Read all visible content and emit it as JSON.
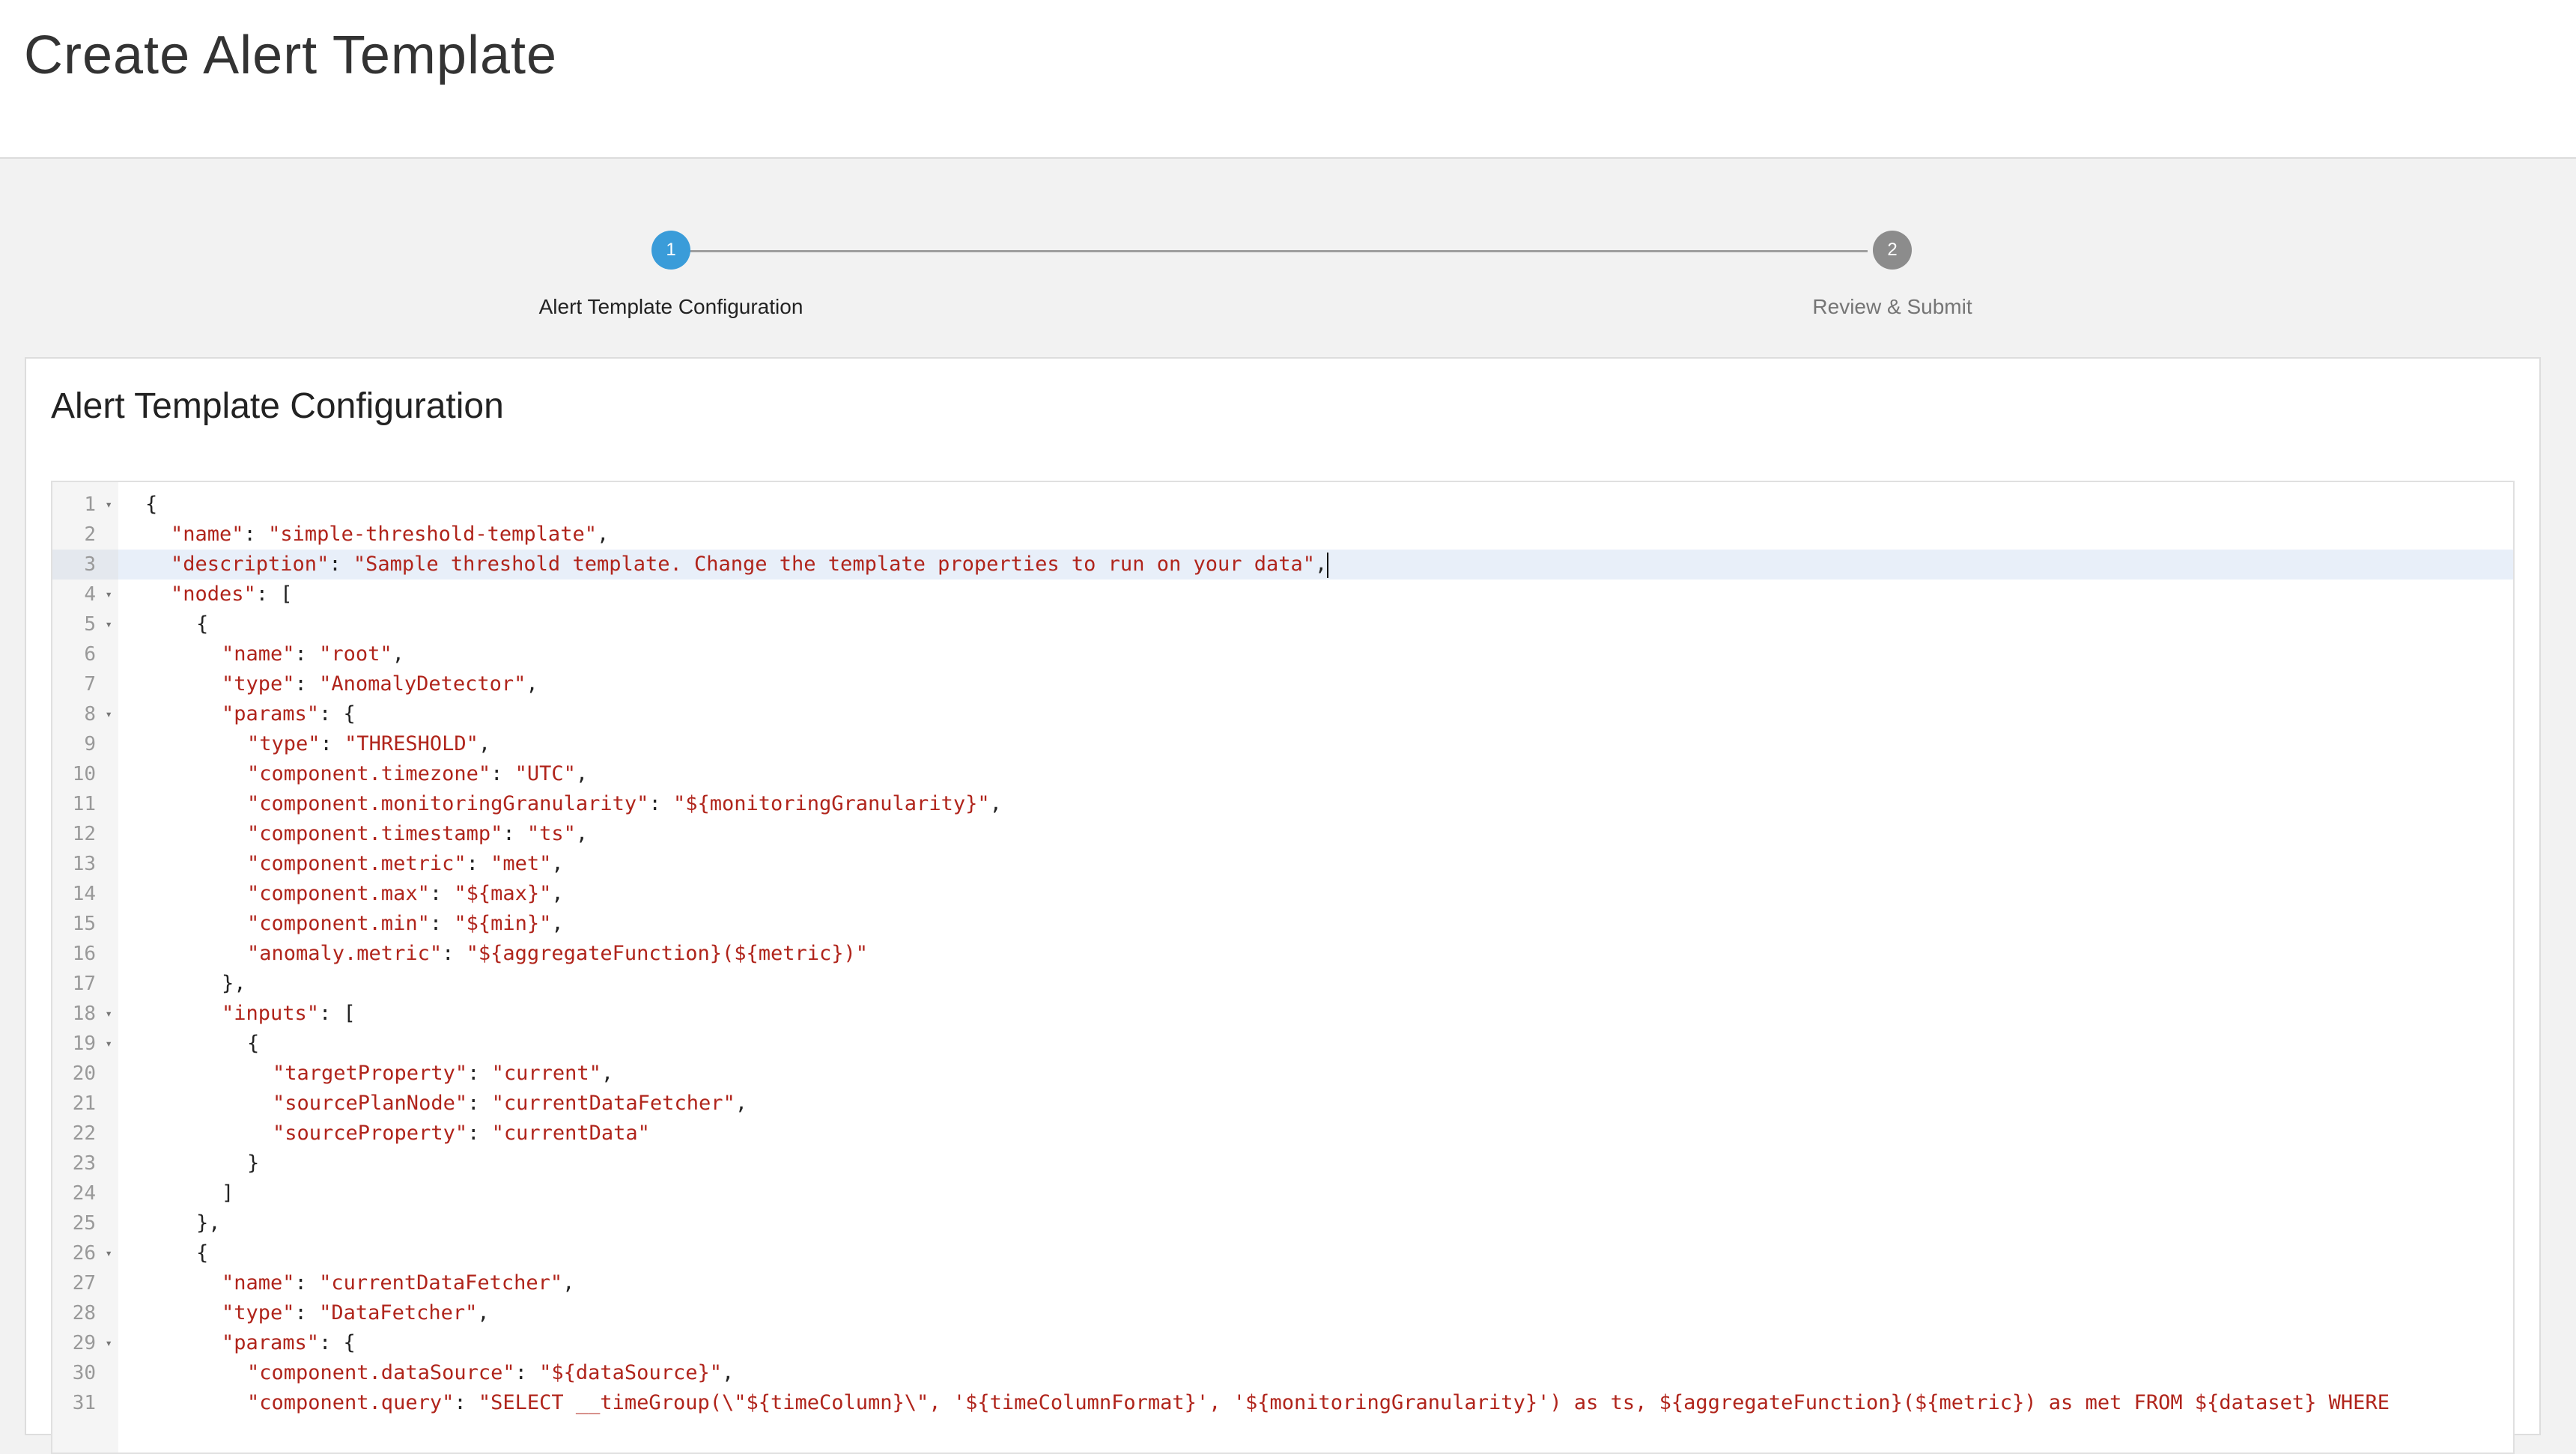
{
  "page": {
    "title": "Create Alert Template"
  },
  "stepper": {
    "steps": [
      {
        "number": "1",
        "label": "Alert Template Configuration",
        "state": "active",
        "color": "#3a9cd9"
      },
      {
        "number": "2",
        "label": "Review & Submit",
        "state": "inactive",
        "color": "#8c8c8c"
      }
    ]
  },
  "card": {
    "title": "Alert Template Configuration"
  },
  "editor": {
    "active_line": 3,
    "lines": [
      {
        "n": "1",
        "fold": true,
        "indent": 0,
        "parts": [
          [
            "p",
            "{"
          ]
        ]
      },
      {
        "n": "2",
        "fold": false,
        "indent": 1,
        "parts": [
          [
            "k",
            "\"name\""
          ],
          [
            "p",
            ": "
          ],
          [
            "s",
            "\"simple-threshold-template\""
          ],
          [
            "p",
            ","
          ]
        ]
      },
      {
        "n": "3",
        "fold": false,
        "indent": 1,
        "parts": [
          [
            "k",
            "\"description\""
          ],
          [
            "p",
            ": "
          ],
          [
            "s",
            "\"Sample threshold template. Change the template properties to run on your data\""
          ],
          [
            "p",
            ","
          ]
        ],
        "cursor": true
      },
      {
        "n": "4",
        "fold": true,
        "indent": 1,
        "parts": [
          [
            "k",
            "\"nodes\""
          ],
          [
            "p",
            ": ["
          ]
        ]
      },
      {
        "n": "5",
        "fold": true,
        "indent": 2,
        "parts": [
          [
            "p",
            "{"
          ]
        ]
      },
      {
        "n": "6",
        "fold": false,
        "indent": 3,
        "parts": [
          [
            "k",
            "\"name\""
          ],
          [
            "p",
            ": "
          ],
          [
            "s",
            "\"root\""
          ],
          [
            "p",
            ","
          ]
        ]
      },
      {
        "n": "7",
        "fold": false,
        "indent": 3,
        "parts": [
          [
            "k",
            "\"type\""
          ],
          [
            "p",
            ": "
          ],
          [
            "s",
            "\"AnomalyDetector\""
          ],
          [
            "p",
            ","
          ]
        ]
      },
      {
        "n": "8",
        "fold": true,
        "indent": 3,
        "parts": [
          [
            "k",
            "\"params\""
          ],
          [
            "p",
            ": {"
          ]
        ]
      },
      {
        "n": "9",
        "fold": false,
        "indent": 4,
        "parts": [
          [
            "k",
            "\"type\""
          ],
          [
            "p",
            ": "
          ],
          [
            "s",
            "\"THRESHOLD\""
          ],
          [
            "p",
            ","
          ]
        ]
      },
      {
        "n": "10",
        "fold": false,
        "indent": 4,
        "parts": [
          [
            "k",
            "\"component.timezone\""
          ],
          [
            "p",
            ": "
          ],
          [
            "s",
            "\"UTC\""
          ],
          [
            "p",
            ","
          ]
        ]
      },
      {
        "n": "11",
        "fold": false,
        "indent": 4,
        "parts": [
          [
            "k",
            "\"component.monitoringGranularity\""
          ],
          [
            "p",
            ": "
          ],
          [
            "s",
            "\"${monitoringGranularity}\""
          ],
          [
            "p",
            ","
          ]
        ]
      },
      {
        "n": "12",
        "fold": false,
        "indent": 4,
        "parts": [
          [
            "k",
            "\"component.timestamp\""
          ],
          [
            "p",
            ": "
          ],
          [
            "s",
            "\"ts\""
          ],
          [
            "p",
            ","
          ]
        ]
      },
      {
        "n": "13",
        "fold": false,
        "indent": 4,
        "parts": [
          [
            "k",
            "\"component.metric\""
          ],
          [
            "p",
            ": "
          ],
          [
            "s",
            "\"met\""
          ],
          [
            "p",
            ","
          ]
        ]
      },
      {
        "n": "14",
        "fold": false,
        "indent": 4,
        "parts": [
          [
            "k",
            "\"component.max\""
          ],
          [
            "p",
            ": "
          ],
          [
            "s",
            "\"${max}\""
          ],
          [
            "p",
            ","
          ]
        ]
      },
      {
        "n": "15",
        "fold": false,
        "indent": 4,
        "parts": [
          [
            "k",
            "\"component.min\""
          ],
          [
            "p",
            ": "
          ],
          [
            "s",
            "\"${min}\""
          ],
          [
            "p",
            ","
          ]
        ]
      },
      {
        "n": "16",
        "fold": false,
        "indent": 4,
        "parts": [
          [
            "k",
            "\"anomaly.metric\""
          ],
          [
            "p",
            ": "
          ],
          [
            "s",
            "\"${aggregateFunction}(${metric})\""
          ]
        ]
      },
      {
        "n": "17",
        "fold": false,
        "indent": 3,
        "parts": [
          [
            "p",
            "},"
          ]
        ]
      },
      {
        "n": "18",
        "fold": true,
        "indent": 3,
        "parts": [
          [
            "k",
            "\"inputs\""
          ],
          [
            "p",
            ": ["
          ]
        ]
      },
      {
        "n": "19",
        "fold": true,
        "indent": 4,
        "parts": [
          [
            "p",
            "{"
          ]
        ]
      },
      {
        "n": "20",
        "fold": false,
        "indent": 5,
        "parts": [
          [
            "k",
            "\"targetProperty\""
          ],
          [
            "p",
            ": "
          ],
          [
            "s",
            "\"current\""
          ],
          [
            "p",
            ","
          ]
        ]
      },
      {
        "n": "21",
        "fold": false,
        "indent": 5,
        "parts": [
          [
            "k",
            "\"sourcePlanNode\""
          ],
          [
            "p",
            ": "
          ],
          [
            "s",
            "\"currentDataFetcher\""
          ],
          [
            "p",
            ","
          ]
        ]
      },
      {
        "n": "22",
        "fold": false,
        "indent": 5,
        "parts": [
          [
            "k",
            "\"sourceProperty\""
          ],
          [
            "p",
            ": "
          ],
          [
            "s",
            "\"currentData\""
          ]
        ]
      },
      {
        "n": "23",
        "fold": false,
        "indent": 4,
        "parts": [
          [
            "p",
            "}"
          ]
        ]
      },
      {
        "n": "24",
        "fold": false,
        "indent": 3,
        "parts": [
          [
            "p",
            "]"
          ]
        ]
      },
      {
        "n": "25",
        "fold": false,
        "indent": 2,
        "parts": [
          [
            "p",
            "},"
          ]
        ]
      },
      {
        "n": "26",
        "fold": true,
        "indent": 2,
        "parts": [
          [
            "p",
            "{"
          ]
        ]
      },
      {
        "n": "27",
        "fold": false,
        "indent": 3,
        "parts": [
          [
            "k",
            "\"name\""
          ],
          [
            "p",
            ": "
          ],
          [
            "s",
            "\"currentDataFetcher\""
          ],
          [
            "p",
            ","
          ]
        ]
      },
      {
        "n": "28",
        "fold": false,
        "indent": 3,
        "parts": [
          [
            "k",
            "\"type\""
          ],
          [
            "p",
            ": "
          ],
          [
            "s",
            "\"DataFetcher\""
          ],
          [
            "p",
            ","
          ]
        ]
      },
      {
        "n": "29",
        "fold": true,
        "indent": 3,
        "parts": [
          [
            "k",
            "\"params\""
          ],
          [
            "p",
            ": {"
          ]
        ]
      },
      {
        "n": "30",
        "fold": false,
        "indent": 4,
        "parts": [
          [
            "k",
            "\"component.dataSource\""
          ],
          [
            "p",
            ": "
          ],
          [
            "s",
            "\"${dataSource}\""
          ],
          [
            "p",
            ","
          ]
        ]
      },
      {
        "n": "31",
        "fold": false,
        "indent": 4,
        "parts": [
          [
            "k",
            "\"component.query\""
          ],
          [
            "p",
            ": "
          ],
          [
            "s",
            "\"SELECT __timeGroup(\\\"${timeColumn}\\\", '${timeColumnFormat}', '${monitoringGranularity}') as ts, ${aggregateFunction}(${metric}) as met FROM ${dataset} WHERE"
          ]
        ]
      }
    ]
  }
}
